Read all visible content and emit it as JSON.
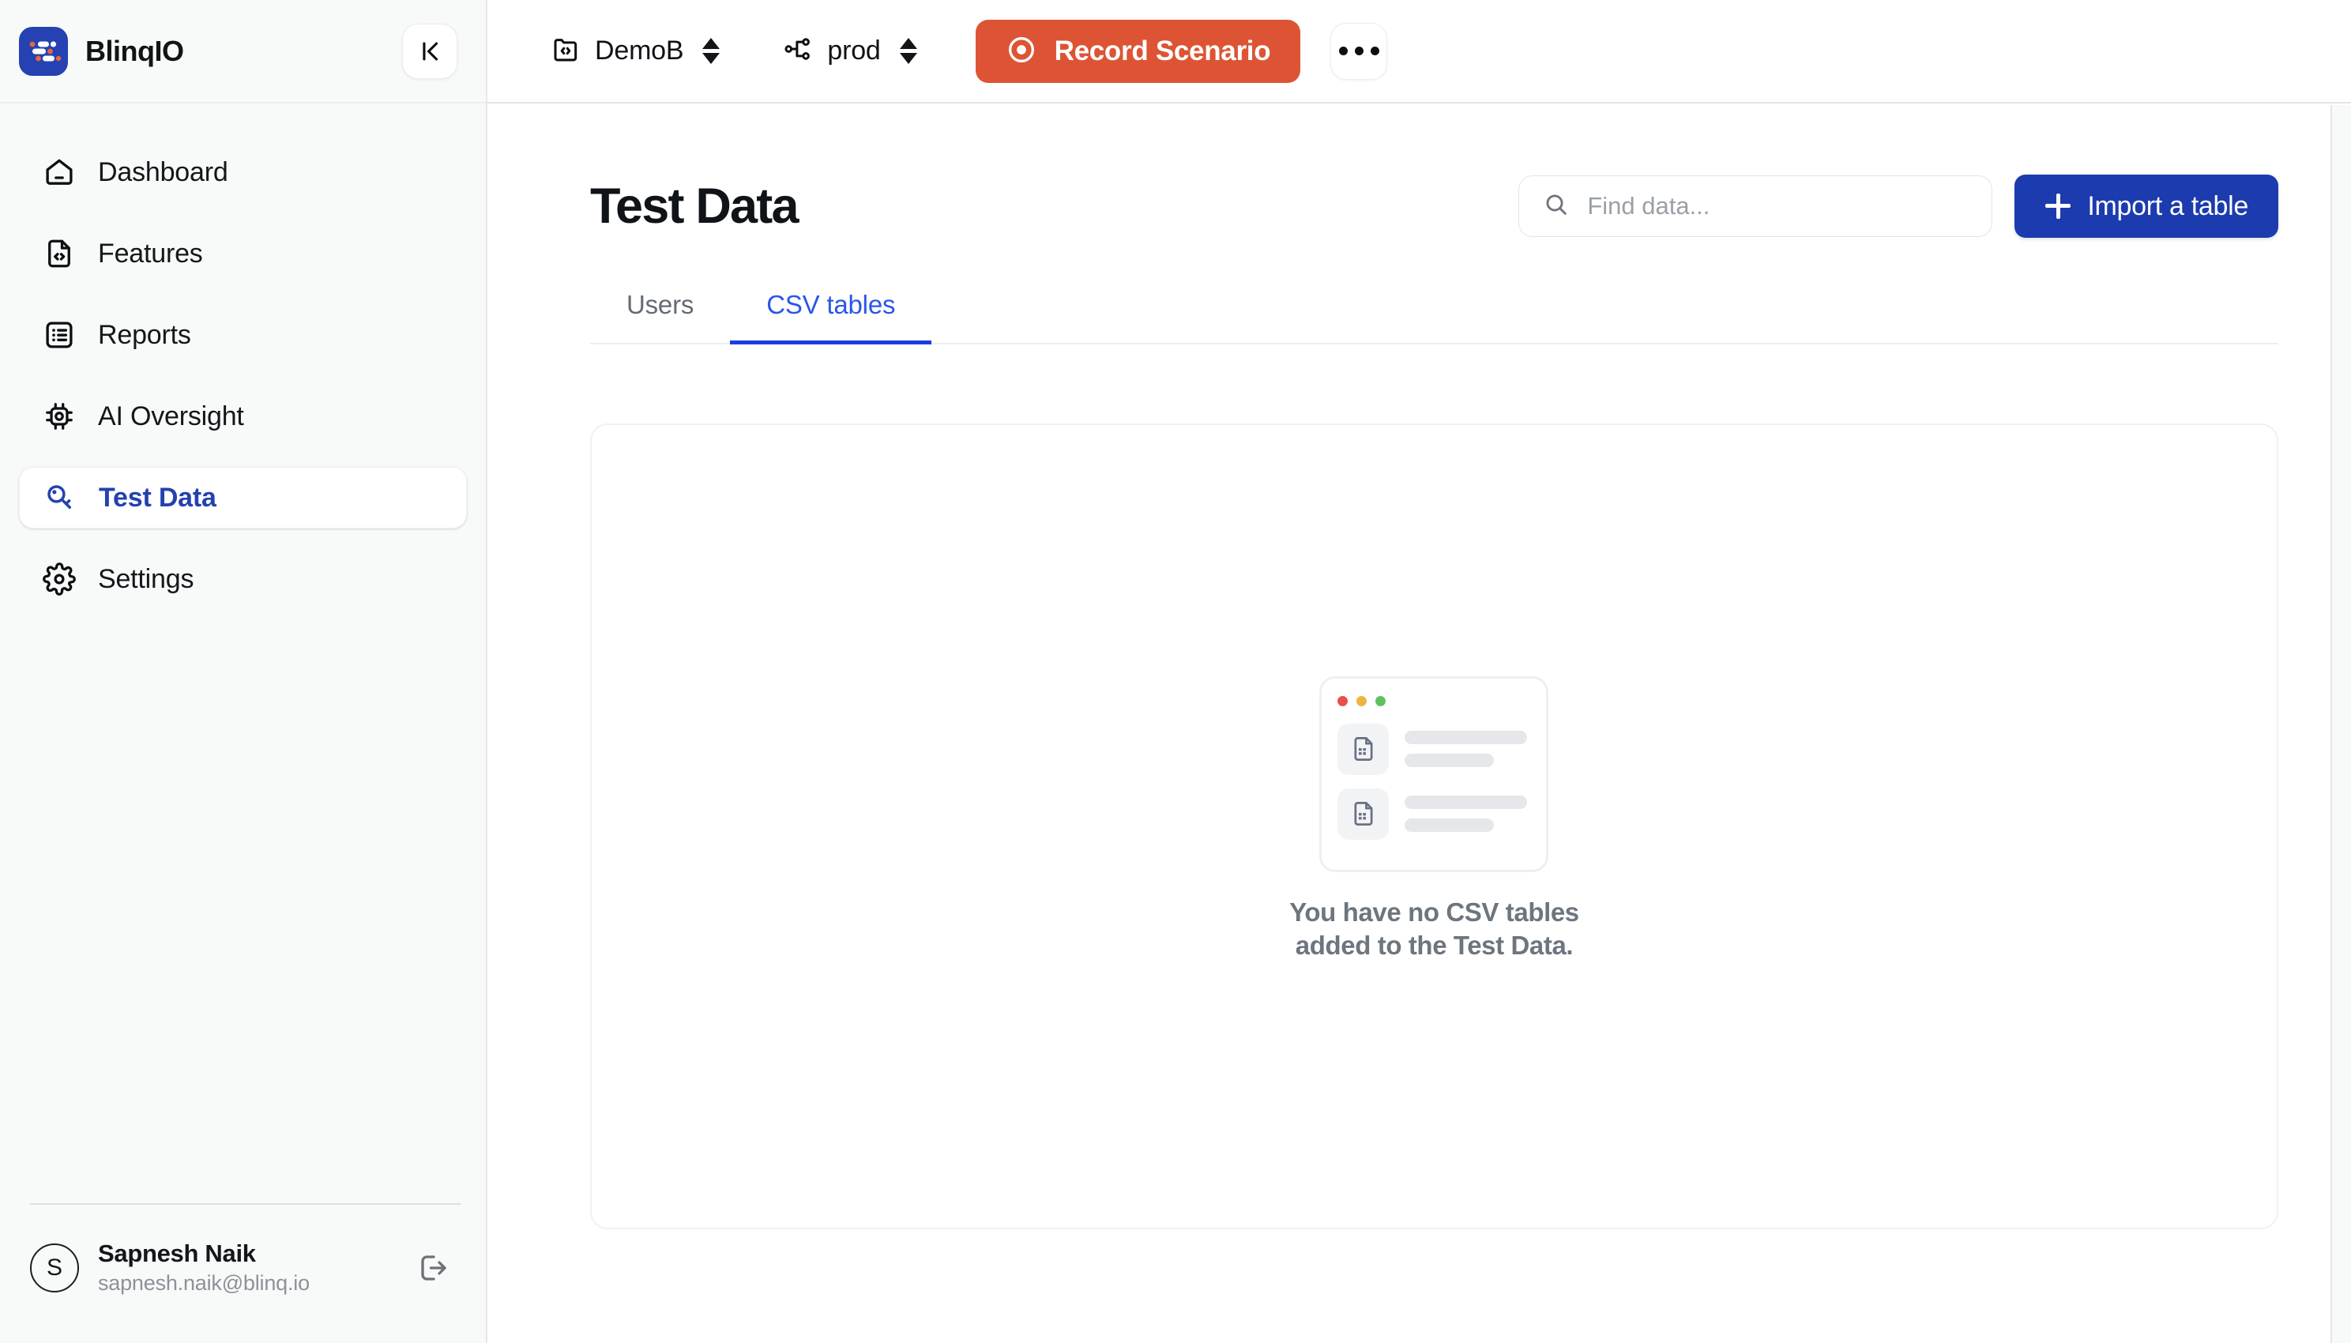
{
  "brand": {
    "name": "BlinqIO",
    "logo_icon": "blinqio-logo",
    "accent": "#2541b2"
  },
  "sidebar": {
    "collapse_icon": "collapse-panel-icon",
    "items": [
      {
        "label": "Dashboard",
        "icon": "home-icon",
        "active": false
      },
      {
        "label": "Features",
        "icon": "file-code-icon",
        "active": false
      },
      {
        "label": "Reports",
        "icon": "list-icon",
        "active": false
      },
      {
        "label": "AI Oversight",
        "icon": "cpu-gear-icon",
        "active": false
      },
      {
        "label": "Test Data",
        "icon": "key-icon",
        "active": true
      },
      {
        "label": "Settings",
        "icon": "gear-icon",
        "active": false
      }
    ],
    "user": {
      "initial": "S",
      "name": "Sapnesh Naik",
      "email": "sapnesh.naik@blinq.io",
      "logout_icon": "logout-icon"
    }
  },
  "topbar": {
    "project": {
      "label": "DemoB",
      "icon": "folder-code-icon"
    },
    "environment": {
      "label": "prod",
      "icon": "network-nodes-icon"
    },
    "record": {
      "label": "Record Scenario",
      "icon": "record-circle-icon",
      "color": "#dd5434"
    },
    "more": {
      "icon": "ellipsis-icon"
    }
  },
  "main": {
    "title": "Test Data",
    "search": {
      "placeholder": "Find data...",
      "value": "",
      "icon": "search-icon"
    },
    "import": {
      "label": "Import a table",
      "icon": "plus-icon",
      "color": "#1c3bae"
    },
    "tabs": [
      {
        "label": "Users",
        "active": false
      },
      {
        "label": "CSV tables",
        "active": true
      }
    ],
    "empty_state": {
      "line1": "You have no CSV tables",
      "line2": "added to the Test Data.",
      "illustration_icon": "csv-file-icon",
      "window_dots": [
        "#e8514b",
        "#edb441",
        "#5fc25f"
      ]
    }
  }
}
